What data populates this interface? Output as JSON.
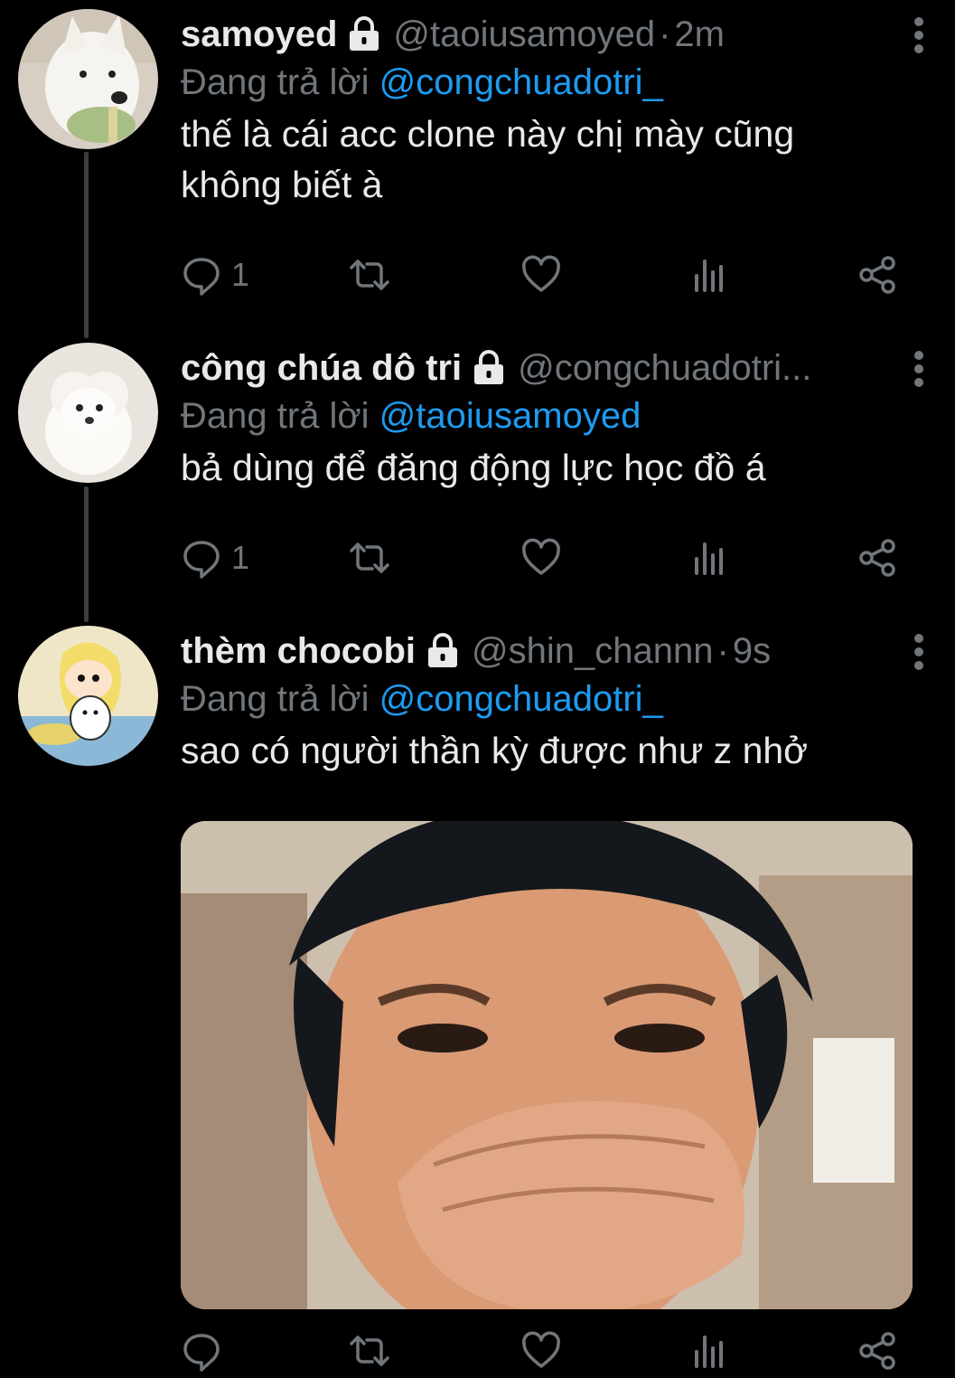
{
  "tweets": [
    {
      "name": "samoyed",
      "handle": "@taoiusamoyed",
      "sep": "·",
      "time": "2m",
      "reply_label": "Đang trả lời",
      "reply_handle": "@congchuadotri_",
      "text": "thế là cái acc clone này chị mày cũng không biết à",
      "reply_count": "1",
      "avatar_icon": "samoyed-avatar"
    },
    {
      "name": "công chúa dô tri",
      "handle": "@congchuadotri...",
      "sep": "",
      "time": "",
      "reply_label": "Đang trả lời",
      "reply_handle": "@taoiusamoyed",
      "text": "bả dùng để đăng động lực học đồ á",
      "reply_count": "1",
      "avatar_icon": "white-puppy-avatar"
    },
    {
      "name": "thèm chocobi",
      "handle": "@shin_channn",
      "sep": "·",
      "time": "9s",
      "reply_label": "Đang trả lời",
      "reply_handle": "@congchuadotri_",
      "text": "sao có người thần kỳ được như z nhở",
      "reply_count": "",
      "avatar_icon": "shinchan-avatar",
      "media": "crying-boy-photo"
    }
  ],
  "colors": {
    "background": "#000000",
    "text": "#e7e9ea",
    "muted": "#71767b",
    "link": "#1d9bf0"
  }
}
